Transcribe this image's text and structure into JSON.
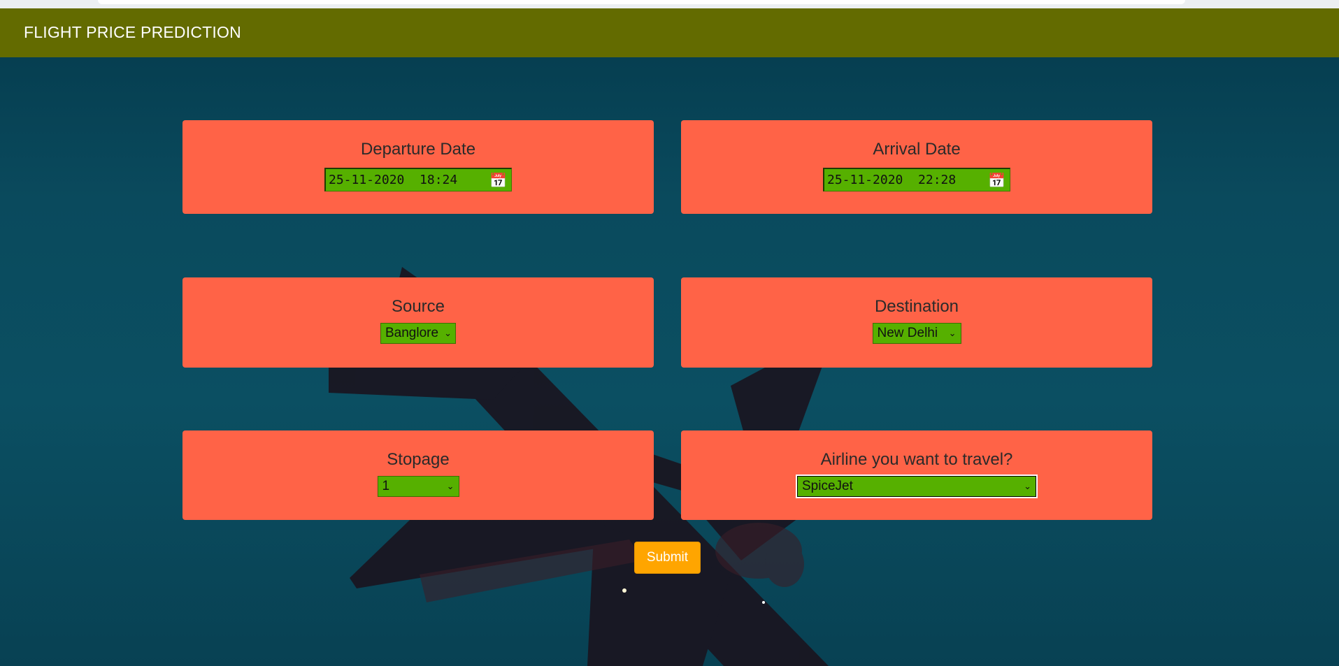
{
  "navbar": {
    "brand": "FLIGHT PRICE PREDICTION"
  },
  "form": {
    "departure": {
      "label": "Departure Date",
      "value": "25-11-2020  18:24",
      "icon": "calendar-icon"
    },
    "arrival": {
      "label": "Arrival Date",
      "value": "25-11-2020  22:28",
      "icon": "calendar-icon"
    },
    "source": {
      "label": "Source",
      "selected": "Banglore"
    },
    "destination": {
      "label": "Destination",
      "selected": "New Delhi"
    },
    "stopage": {
      "label": "Stopage",
      "selected": "1"
    },
    "airline": {
      "label": "Airline you want to travel?",
      "selected": "SpiceJet"
    },
    "submit_label": "Submit"
  },
  "colors": {
    "navbar": "#636b00",
    "card": "#ff6347",
    "input": "#56b000",
    "submit": "#ffa500",
    "background": "#0b4f62"
  }
}
